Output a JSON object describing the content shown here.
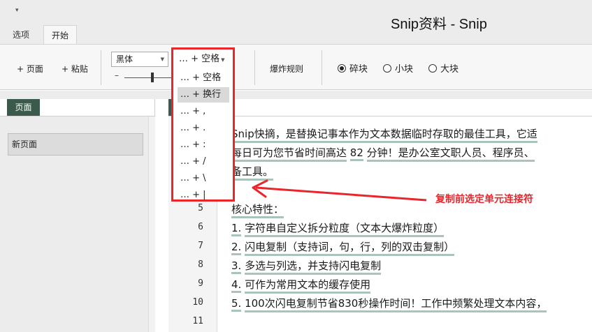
{
  "window": {
    "title": "Snip资料 - Snip",
    "qat_glyph": "▾"
  },
  "tabs": [
    {
      "label": "选项"
    },
    {
      "label": "开始"
    }
  ],
  "ribbon": {
    "add_page": "+ 页面",
    "paste": "+ 粘贴",
    "font": "黑体",
    "connector": "… + 空格",
    "explode_rules": "爆炸规则",
    "radios": [
      {
        "label": "碎块",
        "checked": true
      },
      {
        "label": "小块",
        "checked": false
      },
      {
        "label": "大块",
        "checked": false
      }
    ],
    "slider_minus": "–"
  },
  "connector_dropdown": {
    "items": [
      {
        "label": "… + 空格",
        "selected": false
      },
      {
        "label": "… + 换行",
        "selected": true
      },
      {
        "label": "… + ,",
        "selected": false
      },
      {
        "label": "… + .",
        "selected": false
      },
      {
        "label": "… + :",
        "selected": false
      },
      {
        "label": "… + /",
        "selected": false
      },
      {
        "label": "… + \\",
        "selected": false
      },
      {
        "label": "… + |",
        "selected": false
      }
    ]
  },
  "left_pane": {
    "tab": "页面",
    "pages": [
      "新页面"
    ]
  },
  "editor": {
    "lines": [
      {
        "num": "",
        "tokens": [
          "Snip快摘，是替换记事本作为文本数据临时存取的最佳工具，它适"
        ]
      },
      {
        "num": "",
        "tokens": [
          "每日可为您节省时间高达",
          "82",
          "分钟！是办公室文职人员、程序员、"
        ]
      },
      {
        "num": "",
        "tokens": [
          "备工具。"
        ]
      },
      {
        "num": "",
        "tokens": []
      },
      {
        "num": "5",
        "tokens": [
          "核心特性："
        ]
      },
      {
        "num": "6",
        "tokens": [
          "1.",
          "字符串自定义拆分粒度（文本大爆炸粒度）"
        ]
      },
      {
        "num": "7",
        "tokens": [
          "2.",
          "闪电复制（支持词，句，行，列的双击复制）"
        ]
      },
      {
        "num": "8",
        "tokens": [
          "3.",
          "多选与列选，并支持闪电复制"
        ]
      },
      {
        "num": "9",
        "tokens": [
          "4.",
          "可作为常用文本的缓存使用"
        ]
      },
      {
        "num": "10",
        "tokens": [
          "5.",
          "100次闪电复制节省830秒操作时间！工作中频繁处理文本内容，"
        ]
      },
      {
        "num": "11",
        "tokens": []
      }
    ]
  },
  "annotation": {
    "text": "复制前选定单元连接符",
    "color": "#e8262c"
  },
  "colors": {
    "accent": "#3c5a4c",
    "token_underline": "#a9c4ba",
    "annotation_red": "#e8262c"
  }
}
